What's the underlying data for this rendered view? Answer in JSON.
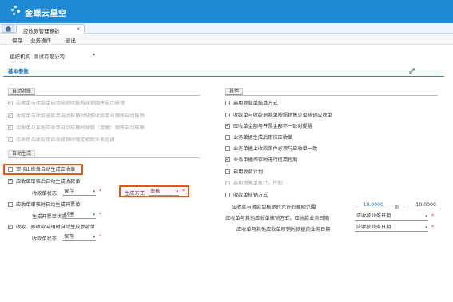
{
  "header": {
    "logo_text": "金蝶云星空",
    "tab_label": "应收款管理参数",
    "tab_close": "×"
  },
  "toolbar": {
    "save_label": "保存",
    "auxiliary_label": "业务操作",
    "exit_label": "退出"
  },
  "org": {
    "label": "组织机构",
    "value": "测试有限公司"
  },
  "section": {
    "title": "基本参数"
  },
  "auto_reconcile": {
    "title": "自动对账",
    "items": [
      {
        "label": "应收单与收款单自动核销时按照核销顺序自动核销",
        "checked": true,
        "disabled": true
      },
      {
        "label": "收款单与收款退款单自动核销时按照收款单号顺序自动核销",
        "checked": true,
        "disabled": true
      },
      {
        "label": "应收单与其他应收单自动核销时按照（单据）顺序自动核销",
        "checked": true,
        "disabled": true
      },
      {
        "label": "应收单与收款单自动核销时限定相同业务组织",
        "checked": false,
        "disabled": true
      }
    ]
  },
  "auto_generate": {
    "title": "自动生成",
    "item1": {
      "label": "审核出库单自动生成应收单",
      "checked": false
    },
    "item2": {
      "label": "应收单审核后自动生成收款单",
      "checked": true
    },
    "item2_field_label": "收款单状态",
    "item2_field_value": "保存",
    "item2_biz_label": "生成方式",
    "item2_biz_value": "审核",
    "item3": {
      "label": "应收单审核时自动生成开票单",
      "checked": false
    },
    "item3_field_label": "生成开票单状态",
    "item3_field_value": "创建",
    "item4": {
      "label": "收款、预收款冲销时自动生成收款单",
      "checked": true
    },
    "item4_field_label": "收款单状态",
    "item4_field_value": "保存"
  },
  "other": {
    "title": "其他",
    "items": [
      {
        "label": "启用收款单结算方式",
        "checked": false,
        "disabled": false
      },
      {
        "label": "收款单与收款退款单按照销售订单核销应收单",
        "checked": false,
        "disabled": false
      },
      {
        "label": "应收单金额与开票金额不一致时提醒",
        "checked": true,
        "disabled": false
      },
      {
        "label": "业务单据生成后审核应收单",
        "checked": false,
        "disabled": false
      },
      {
        "label": "业务单据上收款条件必须与应收单一致",
        "checked": false,
        "disabled": false
      },
      {
        "label": "业务单据保存时进行信用控制",
        "checked": true,
        "disabled": false
      },
      {
        "label": "启用收款计划",
        "checked": false,
        "disabled": false
      },
      {
        "label": "启用销售单执行，控制",
        "checked": true,
        "disabled": true
      },
      {
        "label": "收款单核销方式",
        "checked": false,
        "disabled": false
      }
    ],
    "tolerance_label": "应收款与收款单核销时允许的差额范围",
    "tolerance_from": "10.0000",
    "tolerance_sep": "到",
    "tolerance_to": "10.0000",
    "row2_label": "应收单与其他应收单核销方式，应收款业务日期",
    "row2_value": "应收款业务日期",
    "row3_label": "应收单与其他应收单核销时依据的业务日期",
    "row3_value": "应收款业务日期"
  },
  "colors": {
    "brand": "#1d8ad6",
    "highlight": "#e8541c",
    "required": "#e0261f"
  }
}
